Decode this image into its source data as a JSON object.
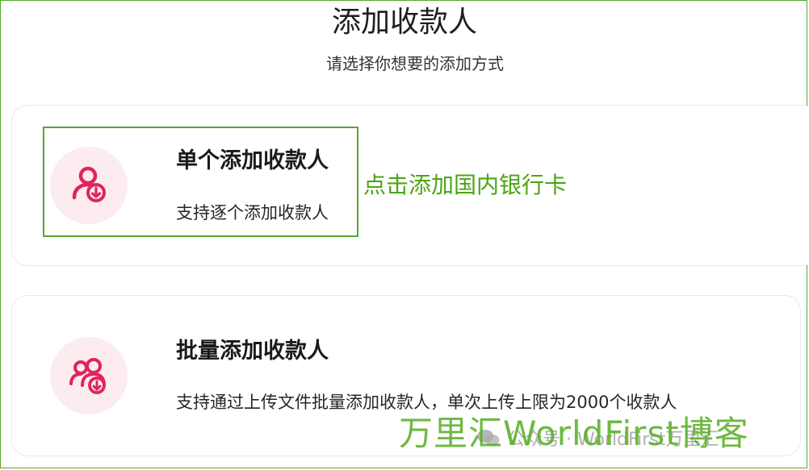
{
  "header": {
    "title": "添加收款人",
    "subtitle": "请选择你想要的添加方式"
  },
  "options": [
    {
      "title": "单个添加收款人",
      "description": "支持逐个添加收款人",
      "icon": "single-user-download-icon"
    },
    {
      "title": "批量添加收款人",
      "description": "支持通过上传文件批量添加收款人，单次上传上限为2000个收款人",
      "icon": "multi-user-download-icon"
    }
  ],
  "annotation": "点击添加国内银行卡",
  "watermark": {
    "main": "万里汇WorldFirst博客",
    "wechat": "公众号 · WorldFirst万里汇"
  },
  "colors": {
    "accent_icon": "#e0245e",
    "icon_bg": "#fcecef",
    "annotation_green": "#4aa514",
    "frame_border": "#55aa2a"
  }
}
